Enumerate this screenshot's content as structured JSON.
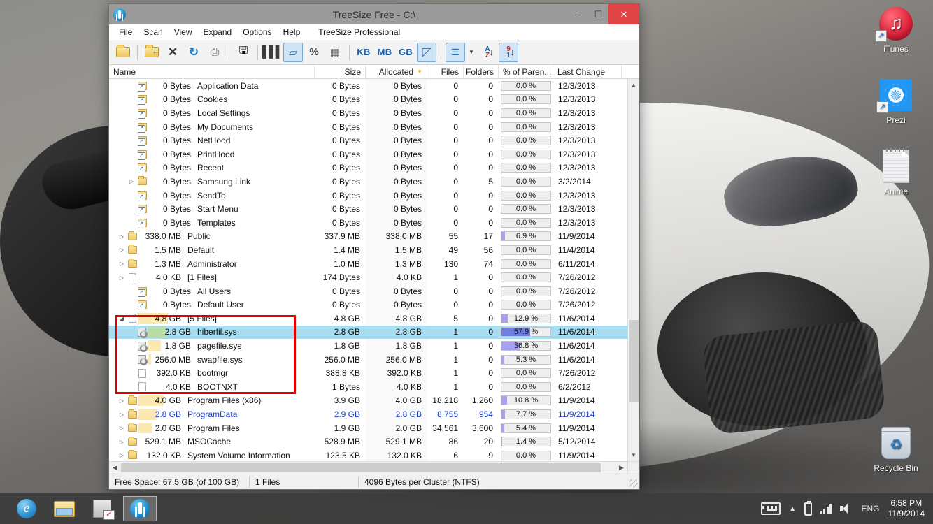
{
  "desktop": {
    "icons": [
      {
        "name": "iTunes",
        "icon": "itunes-icon",
        "shortcut": true
      },
      {
        "name": "Prezi",
        "icon": "prezi-icon",
        "shortcut": true
      },
      {
        "name": "Anime",
        "icon": "document-icon",
        "shortcut": false
      },
      {
        "name": "Recycle Bin",
        "icon": "recycle-bin-icon",
        "shortcut": false
      }
    ]
  },
  "window": {
    "title": "TreeSize Free - C:\\",
    "logo_icon": "treesize-logo-icon",
    "buttons": {
      "minimize": "–",
      "maximize": "☐",
      "close": "✕"
    },
    "menu": [
      "File",
      "Scan",
      "View",
      "Expand",
      "Options",
      "Help",
      "TreeSize Professional"
    ],
    "toolbar": [
      {
        "id": "open-folder",
        "icon": "open-folder-icon",
        "type": "icon",
        "label": ""
      },
      {
        "id": "sep1",
        "type": "sep"
      },
      {
        "id": "scan-folder",
        "icon": "scan-folder-icon",
        "type": "icon",
        "label": ""
      },
      {
        "id": "cancel",
        "icon": "cancel-x-icon",
        "type": "glyph",
        "label": "✕"
      },
      {
        "id": "refresh",
        "icon": "refresh-icon",
        "type": "glyph",
        "label": "↻"
      },
      {
        "id": "print",
        "icon": "printer-icon",
        "type": "glyph",
        "label": "⎙"
      },
      {
        "id": "sep2",
        "type": "sep"
      },
      {
        "id": "save",
        "icon": "save-disk-icon",
        "type": "glyph",
        "label": "ὋE"
      },
      {
        "id": "sep3",
        "type": "sep"
      },
      {
        "id": "columns",
        "icon": "columns-icon",
        "type": "glyph",
        "label": "▐▐▐"
      },
      {
        "id": "size-mode",
        "icon": "disk-size-icon",
        "type": "glyph",
        "label": "▱",
        "active": true
      },
      {
        "id": "percent-mode",
        "icon": "percent-icon",
        "type": "glyph",
        "label": "%"
      },
      {
        "id": "file-count",
        "icon": "file-count-icon",
        "type": "glyph",
        "label": "▦"
      },
      {
        "id": "sep4",
        "type": "sep"
      },
      {
        "id": "unit-kb",
        "icon": "kb-unit-icon",
        "type": "text",
        "label": "KB"
      },
      {
        "id": "unit-mb",
        "icon": "mb-unit-icon",
        "type": "text",
        "label": "MB"
      },
      {
        "id": "unit-gb",
        "icon": "gb-unit-icon",
        "type": "text",
        "label": "GB"
      },
      {
        "id": "scale-mode",
        "icon": "triangle-ruler-icon",
        "type": "glyph",
        "label": "◺",
        "active": true
      },
      {
        "id": "sep5",
        "type": "sep"
      },
      {
        "id": "details-view",
        "icon": "details-list-icon",
        "type": "glyph",
        "label": "☰",
        "active": true
      },
      {
        "id": "details-caret",
        "icon": "chevron-down-icon",
        "type": "caret",
        "label": "▼"
      },
      {
        "id": "sort-az",
        "icon": "sort-alpha-icon",
        "type": "sortaz",
        "label": "A↓"
      },
      {
        "id": "sort-91",
        "icon": "sort-numeric-icon",
        "type": "sort91",
        "label": "9↓",
        "active": true
      }
    ],
    "columns": [
      {
        "key": "name",
        "label": "Name",
        "align": "left",
        "sorted": false
      },
      {
        "key": "size",
        "label": "Size",
        "align": "right",
        "sorted": false
      },
      {
        "key": "alloc",
        "label": "Allocated",
        "align": "right",
        "sorted": true,
        "sort_dir": "desc"
      },
      {
        "key": "files",
        "label": "Files",
        "align": "right",
        "sorted": false
      },
      {
        "key": "folders",
        "label": "Folders",
        "align": "right",
        "sorted": false
      },
      {
        "key": "pct",
        "label": "% of Paren...",
        "align": "center",
        "sorted": false
      },
      {
        "key": "date",
        "label": "Last Change",
        "align": "left",
        "sorted": false
      }
    ],
    "rows": [
      {
        "indent": 1,
        "twisty": "",
        "icon": "shortcut-folder-icon",
        "nsize": "0 Bytes",
        "name": "Application Data",
        "size": "0 Bytes",
        "alloc": "0 Bytes",
        "files": "0",
        "folders": "0",
        "pct": "0.0 %",
        "pctval": 0,
        "date": "12/3/2013",
        "bar": 0
      },
      {
        "indent": 1,
        "twisty": "",
        "icon": "shortcut-folder-icon",
        "nsize": "0 Bytes",
        "name": "Cookies",
        "size": "0 Bytes",
        "alloc": "0 Bytes",
        "files": "0",
        "folders": "0",
        "pct": "0.0 %",
        "pctval": 0,
        "date": "12/3/2013",
        "bar": 0
      },
      {
        "indent": 1,
        "twisty": "",
        "icon": "shortcut-folder-icon",
        "nsize": "0 Bytes",
        "name": "Local Settings",
        "size": "0 Bytes",
        "alloc": "0 Bytes",
        "files": "0",
        "folders": "0",
        "pct": "0.0 %",
        "pctval": 0,
        "date": "12/3/2013",
        "bar": 0
      },
      {
        "indent": 1,
        "twisty": "",
        "icon": "shortcut-folder-icon",
        "nsize": "0 Bytes",
        "name": "My Documents",
        "size": "0 Bytes",
        "alloc": "0 Bytes",
        "files": "0",
        "folders": "0",
        "pct": "0.0 %",
        "pctval": 0,
        "date": "12/3/2013",
        "bar": 0
      },
      {
        "indent": 1,
        "twisty": "",
        "icon": "shortcut-folder-icon",
        "nsize": "0 Bytes",
        "name": "NetHood",
        "size": "0 Bytes",
        "alloc": "0 Bytes",
        "files": "0",
        "folders": "0",
        "pct": "0.0 %",
        "pctval": 0,
        "date": "12/3/2013",
        "bar": 0
      },
      {
        "indent": 1,
        "twisty": "",
        "icon": "shortcut-folder-icon",
        "nsize": "0 Bytes",
        "name": "PrintHood",
        "size": "0 Bytes",
        "alloc": "0 Bytes",
        "files": "0",
        "folders": "0",
        "pct": "0.0 %",
        "pctval": 0,
        "date": "12/3/2013",
        "bar": 0
      },
      {
        "indent": 1,
        "twisty": "",
        "icon": "shortcut-folder-icon",
        "nsize": "0 Bytes",
        "name": "Recent",
        "size": "0 Bytes",
        "alloc": "0 Bytes",
        "files": "0",
        "folders": "0",
        "pct": "0.0 %",
        "pctval": 0,
        "date": "12/3/2013",
        "bar": 0
      },
      {
        "indent": 1,
        "twisty": "▷",
        "icon": "folder-icon",
        "nsize": "0 Bytes",
        "name": "Samsung Link",
        "size": "0 Bytes",
        "alloc": "0 Bytes",
        "files": "0",
        "folders": "5",
        "pct": "0.0 %",
        "pctval": 0,
        "date": "3/2/2014",
        "bar": 0
      },
      {
        "indent": 1,
        "twisty": "",
        "icon": "shortcut-folder-icon",
        "nsize": "0 Bytes",
        "name": "SendTo",
        "size": "0 Bytes",
        "alloc": "0 Bytes",
        "files": "0",
        "folders": "0",
        "pct": "0.0 %",
        "pctval": 0,
        "date": "12/3/2013",
        "bar": 0
      },
      {
        "indent": 1,
        "twisty": "",
        "icon": "shortcut-folder-icon",
        "nsize": "0 Bytes",
        "name": "Start Menu",
        "size": "0 Bytes",
        "alloc": "0 Bytes",
        "files": "0",
        "folders": "0",
        "pct": "0.0 %",
        "pctval": 0,
        "date": "12/3/2013",
        "bar": 0
      },
      {
        "indent": 1,
        "twisty": "",
        "icon": "shortcut-folder-icon",
        "nsize": "0 Bytes",
        "name": "Templates",
        "size": "0 Bytes",
        "alloc": "0 Bytes",
        "files": "0",
        "folders": "0",
        "pct": "0.0 %",
        "pctval": 0,
        "date": "12/3/2013",
        "bar": 0
      },
      {
        "indent": 0,
        "twisty": "▷",
        "icon": "folder-icon",
        "nsize": "338.0 MB",
        "name": "Public",
        "size": "337.9 MB",
        "alloc": "338.0 MB",
        "files": "55",
        "folders": "17",
        "pct": "6.9 %",
        "pctval": 6.9,
        "date": "11/9/2014",
        "bar": 0
      },
      {
        "indent": 0,
        "twisty": "▷",
        "icon": "folder-icon",
        "nsize": "1.5 MB",
        "name": "Default",
        "size": "1.4 MB",
        "alloc": "1.5 MB",
        "files": "49",
        "folders": "56",
        "pct": "0.0 %",
        "pctval": 0,
        "date": "11/4/2014",
        "bar": 0
      },
      {
        "indent": 0,
        "twisty": "▷",
        "icon": "folder-icon",
        "nsize": "1.3 MB",
        "name": "Administrator",
        "size": "1.0 MB",
        "alloc": "1.3 MB",
        "files": "130",
        "folders": "74",
        "pct": "0.0 %",
        "pctval": 0,
        "date": "6/11/2014",
        "bar": 0
      },
      {
        "indent": 0,
        "twisty": "▷",
        "icon": "file-icon",
        "nsize": "4.0 KB",
        "name": "[1 Files]",
        "size": "174 Bytes",
        "alloc": "4.0 KB",
        "files": "1",
        "folders": "0",
        "pct": "0.0 %",
        "pctval": 0,
        "date": "7/26/2012",
        "bar": 0
      },
      {
        "indent": 1,
        "twisty": "",
        "icon": "shortcut-folder-icon",
        "nsize": "0 Bytes",
        "name": "All Users",
        "size": "0 Bytes",
        "alloc": "0 Bytes",
        "files": "0",
        "folders": "0",
        "pct": "0.0 %",
        "pctval": 0,
        "date": "7/26/2012",
        "bar": 0
      },
      {
        "indent": 1,
        "twisty": "",
        "icon": "shortcut-folder-icon",
        "nsize": "0 Bytes",
        "name": "Default User",
        "size": "0 Bytes",
        "alloc": "0 Bytes",
        "files": "0",
        "folders": "0",
        "pct": "0.0 %",
        "pctval": 0,
        "date": "7/26/2012",
        "bar": 0
      },
      {
        "indent": 0,
        "twisty": "◢",
        "icon": "file-icon",
        "nsize": "4.8 GB",
        "name": "[5 Files]",
        "size": "4.8 GB",
        "alloc": "4.8 GB",
        "files": "5",
        "folders": "0",
        "pct": "12.9 %",
        "pctval": 12.9,
        "date": "11/6/2014",
        "bar": 42
      },
      {
        "indent": 1,
        "twisty": "",
        "icon": "system-file-icon",
        "nsize": "2.8 GB",
        "name": "hiberfil.sys",
        "size": "2.8 GB",
        "alloc": "2.8 GB",
        "files": "1",
        "folders": "0",
        "pct": "57.9 %",
        "pctval": 57.9,
        "date": "11/6/2014",
        "bar": 26,
        "selected": true
      },
      {
        "indent": 1,
        "twisty": "",
        "icon": "system-file-icon",
        "nsize": "1.8 GB",
        "name": "pagefile.sys",
        "size": "1.8 GB",
        "alloc": "1.8 GB",
        "files": "1",
        "folders": "0",
        "pct": "36.8 %",
        "pctval": 36.8,
        "date": "11/6/2014",
        "bar": 18
      },
      {
        "indent": 1,
        "twisty": "",
        "icon": "system-file-icon",
        "nsize": "256.0 MB",
        "name": "swapfile.sys",
        "size": "256.0 MB",
        "alloc": "256.0 MB",
        "files": "1",
        "folders": "0",
        "pct": "5.3 %",
        "pctval": 5.3,
        "date": "11/6/2014",
        "bar": 4
      },
      {
        "indent": 1,
        "twisty": "",
        "icon": "file-icon",
        "nsize": "392.0 KB",
        "name": "bootmgr",
        "size": "388.8 KB",
        "alloc": "392.0 KB",
        "files": "1",
        "folders": "0",
        "pct": "0.0 %",
        "pctval": 0,
        "date": "7/26/2012",
        "bar": 0
      },
      {
        "indent": 1,
        "twisty": "",
        "icon": "file-icon",
        "nsize": "4.0 KB",
        "name": "BOOTNXT",
        "size": "1 Bytes",
        "alloc": "4.0 KB",
        "files": "1",
        "folders": "0",
        "pct": "0.0 %",
        "pctval": 0,
        "date": "6/2/2012",
        "bar": 0
      },
      {
        "indent": 0,
        "twisty": "▷",
        "icon": "folder-icon",
        "nsize": "4.0 GB",
        "name": "Program Files (x86)",
        "size": "3.9 GB",
        "alloc": "4.0 GB",
        "files": "18,218",
        "folders": "1,260",
        "pct": "10.8 %",
        "pctval": 10.8,
        "date": "11/9/2014",
        "bar": 36
      },
      {
        "indent": 0,
        "twisty": "▷",
        "icon": "folder-icon",
        "nsize": "2.8 GB",
        "name": "ProgramData",
        "size": "2.9 GB",
        "alloc": "2.8 GB",
        "files": "8,755",
        "folders": "954",
        "pct": "7.7 %",
        "pctval": 7.7,
        "date": "11/9/2014",
        "bar": 26,
        "blue": true
      },
      {
        "indent": 0,
        "twisty": "▷",
        "icon": "folder-icon",
        "nsize": "2.0 GB",
        "name": "Program Files",
        "size": "1.9 GB",
        "alloc": "2.0 GB",
        "files": "34,561",
        "folders": "3,600",
        "pct": "5.4 %",
        "pctval": 5.4,
        "date": "11/9/2014",
        "bar": 19
      },
      {
        "indent": 0,
        "twisty": "▷",
        "icon": "folder-icon",
        "nsize": "529.1 MB",
        "name": "MSOCache",
        "size": "528.9 MB",
        "alloc": "529.1 MB",
        "files": "86",
        "folders": "20",
        "pct": "1.4 %",
        "pctval": 1.4,
        "date": "5/12/2014",
        "bar": 0
      },
      {
        "indent": 0,
        "twisty": "▷",
        "icon": "folder-icon",
        "nsize": "132.0 KB",
        "name": "System Volume Information",
        "size": "123.5 KB",
        "alloc": "132.0 KB",
        "files": "6",
        "folders": "9",
        "pct": "0.0 %",
        "pctval": 0,
        "date": "11/9/2014",
        "bar": 0
      }
    ],
    "statusbar": {
      "free_space": "Free Space: 67.5 GB  (of 100 GB)",
      "files": "1  Files",
      "cluster": "4096 Bytes per Cluster (NTFS)"
    },
    "annotation": {
      "type": "red-rectangle",
      "color": "#e10000"
    }
  },
  "taskbar": {
    "apps": [
      {
        "id": "internet-explorer",
        "icon": "internet-explorer-icon",
        "open": false
      },
      {
        "id": "file-explorer",
        "icon": "file-explorer-icon",
        "open": false
      },
      {
        "id": "server-manager",
        "icon": "server-manager-icon",
        "open": false
      },
      {
        "id": "treesize",
        "icon": "treesize-icon",
        "open": true
      }
    ],
    "tray": {
      "keyboard_icon": "keyboard-icon",
      "show_hidden_icon": "chevron-up-icon",
      "battery_icon": "battery-icon",
      "network_icon": "signal-bars-icon",
      "volume_icon": "speaker-icon",
      "language": "ENG",
      "time": "6:58 PM",
      "date": "11/9/2014"
    }
  }
}
